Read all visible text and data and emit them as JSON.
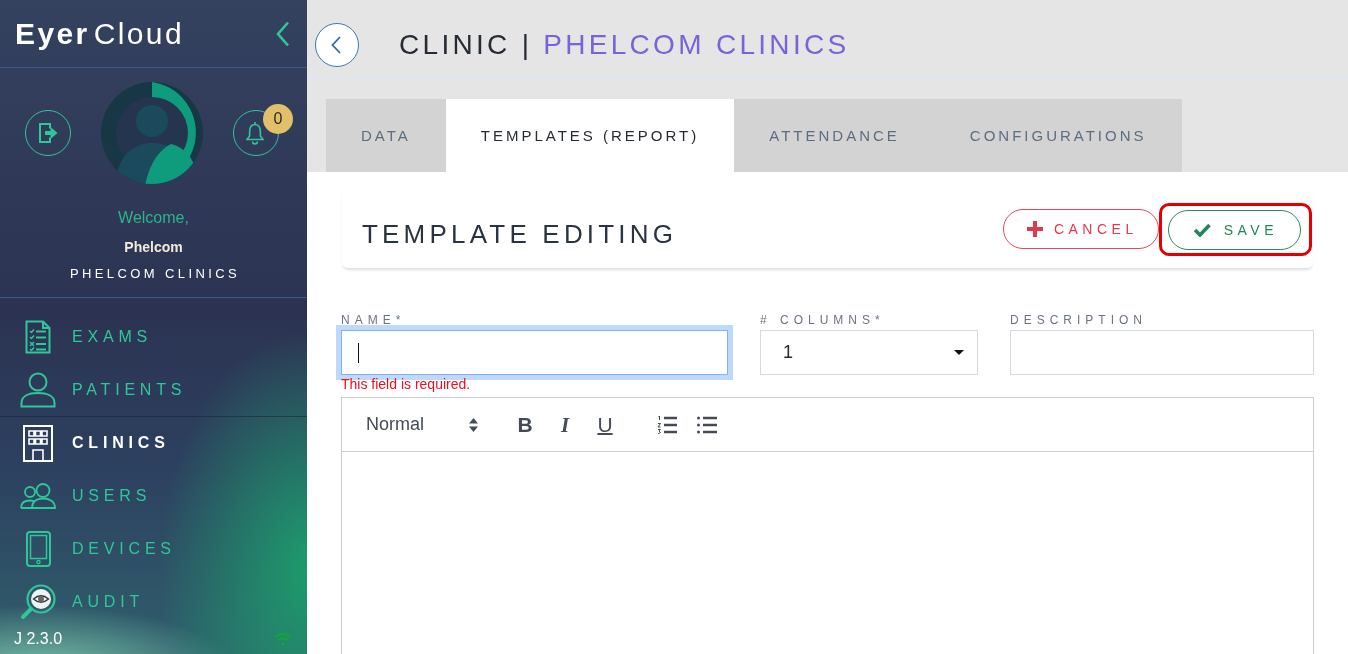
{
  "sidebar": {
    "logo": "**Eyer**Cloud",
    "notification_count": "0",
    "welcome": "Welcome,",
    "user_name": "Phelcom",
    "clinic_name": "PHELCOM CLINICS",
    "nav_items": [
      {
        "kind": "exams",
        "label": "EXAMS",
        "selected": false
      },
      {
        "kind": "patients",
        "label": "PATIENTS",
        "selected": false
      },
      {
        "kind": "clinics",
        "label": "CLINICS",
        "selected": true
      },
      {
        "kind": "users",
        "label": "USERS",
        "selected": false
      },
      {
        "kind": "devices",
        "label": "DEVICES",
        "selected": false
      },
      {
        "kind": "audit",
        "label": "AUDIT",
        "selected": false
      }
    ],
    "version": "J 2.3.0"
  },
  "header": {
    "title": "CLINIC |",
    "subtitle": "PHELCOM CLINICS"
  },
  "tabs": [
    {
      "label": "DATA",
      "selected": false
    },
    {
      "label": "TEMPLATES (REPORT)",
      "selected": true
    },
    {
      "label": "ATTENDANCE",
      "selected": false
    },
    {
      "label": "CONFIGURATIONS",
      "selected": false
    }
  ],
  "template_card": {
    "title": "TEMPLATE EDITING",
    "buttons": [
      {
        "kind": "cancel",
        "label": "CANCEL",
        "highlighted": false
      },
      {
        "kind": "save",
        "label": "SAVE",
        "highlighted": true
      }
    ]
  },
  "form": {
    "fields": [
      {
        "kind": "text",
        "label": "NAME*",
        "focused": true,
        "error": "This field is required."
      },
      {
        "kind": "select",
        "label": "# COLUMNS*",
        "value": "1",
        "focused": false
      },
      {
        "kind": "text",
        "label": "DESCRIPTION",
        "focused": false
      }
    ]
  },
  "editor": {
    "toolbar": {
      "format": "Normal",
      "buttons": [
        {
          "kind": "bold",
          "label": "B"
        },
        {
          "kind": "italic",
          "label": "I"
        },
        {
          "kind": "underline",
          "label": "U"
        },
        {
          "kind": "ordered-list"
        },
        {
          "kind": "bullet-list"
        }
      ]
    }
  }
}
